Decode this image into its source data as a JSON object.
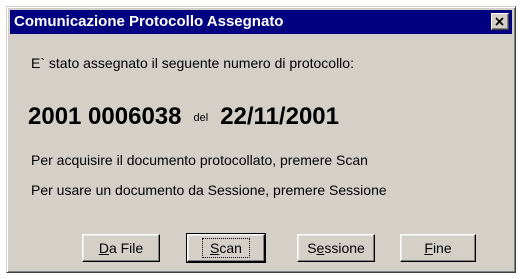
{
  "window": {
    "title": "Comunicazione Protocollo Assegnato"
  },
  "message": {
    "intro": "E` stato assegnato il seguente numero di protocollo:",
    "protocol_number": "2001 0006038",
    "del_label": "del",
    "protocol_date": "22/11/2001",
    "scan_hint": "Per acquisire il documento protocollato, premere Scan",
    "session_hint": "Per usare un documento da Sessione, premere Sessione"
  },
  "buttons": {
    "da_file": {
      "mnemonic": "D",
      "rest": "a File"
    },
    "scan": {
      "mnemonic": "S",
      "rest": "can"
    },
    "sessione": {
      "prefix": "S",
      "mnemonic": "e",
      "rest": "ssione"
    },
    "fine": {
      "mnemonic": "F",
      "rest": "ine"
    }
  },
  "icons": {
    "close": "close-icon"
  }
}
